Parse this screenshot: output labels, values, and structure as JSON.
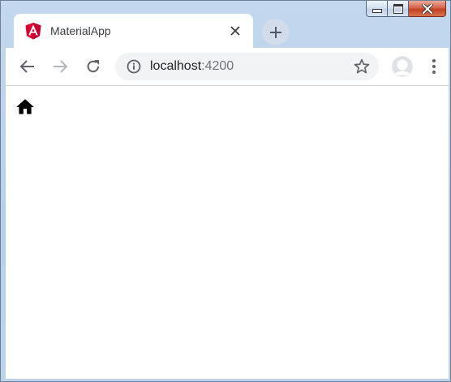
{
  "window": {
    "caption_buttons": [
      "minimize",
      "maximize",
      "close"
    ]
  },
  "tab": {
    "title": "MaterialApp",
    "favicon": "angular-icon",
    "close_icon": "close-icon"
  },
  "new_tab": {
    "icon": "plus-icon"
  },
  "toolbar": {
    "back_icon": "arrow-left-icon",
    "forward_icon": "arrow-right-icon",
    "reload_icon": "reload-icon",
    "address": {
      "host": "localhost",
      "port": ":4200"
    },
    "bookmark_icon": "star-icon",
    "profile_icon": "avatar-icon",
    "menu_icon": "kebab-menu-icon"
  },
  "page": {
    "home_icon": "home-icon"
  },
  "colors": {
    "angular_red": "#dd0031",
    "frame_blue": "#bcd3ec"
  }
}
